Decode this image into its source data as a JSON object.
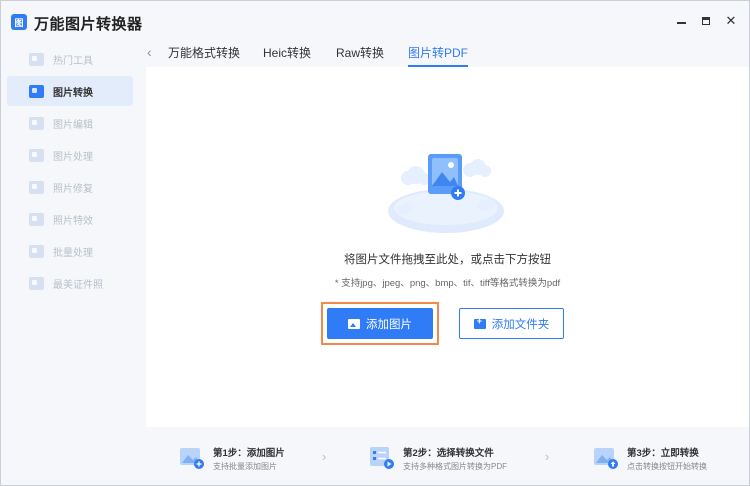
{
  "app": {
    "logo_text": "图",
    "title": "万能图片转换器"
  },
  "window_controls": {
    "close_symbol": "✕"
  },
  "sidebar": {
    "items": [
      {
        "label": "热门工具",
        "active": false
      },
      {
        "label": "图片转换",
        "active": true
      },
      {
        "label": "图片编辑",
        "active": false
      },
      {
        "label": "图片处理",
        "active": false
      },
      {
        "label": "照片修复",
        "active": false
      },
      {
        "label": "照片特效",
        "active": false
      },
      {
        "label": "批量处理",
        "active": false
      },
      {
        "label": "最美证件照",
        "active": false
      }
    ]
  },
  "tabs": {
    "back_symbol": "‹",
    "items": [
      {
        "label": "万能格式转换",
        "active": false
      },
      {
        "label": "Heic转换",
        "active": false
      },
      {
        "label": "Raw转换",
        "active": false
      },
      {
        "label": "图片转PDF",
        "active": true
      }
    ]
  },
  "upload": {
    "drop_hint": "将图片文件拖拽至此处，或点击下方按钮",
    "format_hint": "* 支持jpg、jpeg、png、bmp、tif、tiff等格式转换为pdf",
    "add_image_label": "添加图片",
    "add_folder_label": "添加文件夹"
  },
  "steps": [
    {
      "title": "第1步：添加图片",
      "desc": "支持批量添加图片",
      "icon": "add-image-icon"
    },
    {
      "title": "第2步：选择转换文件",
      "desc": "支持多种格式图片转换为PDF",
      "icon": "select-file-icon"
    },
    {
      "title": "第3步：立即转换",
      "desc": "点击转换按钮开始转换",
      "icon": "convert-icon"
    }
  ],
  "colors": {
    "accent": "#2f7cf6",
    "highlight_border": "#f08a4b",
    "sidebar_active_bg": "#e3ecfb"
  }
}
